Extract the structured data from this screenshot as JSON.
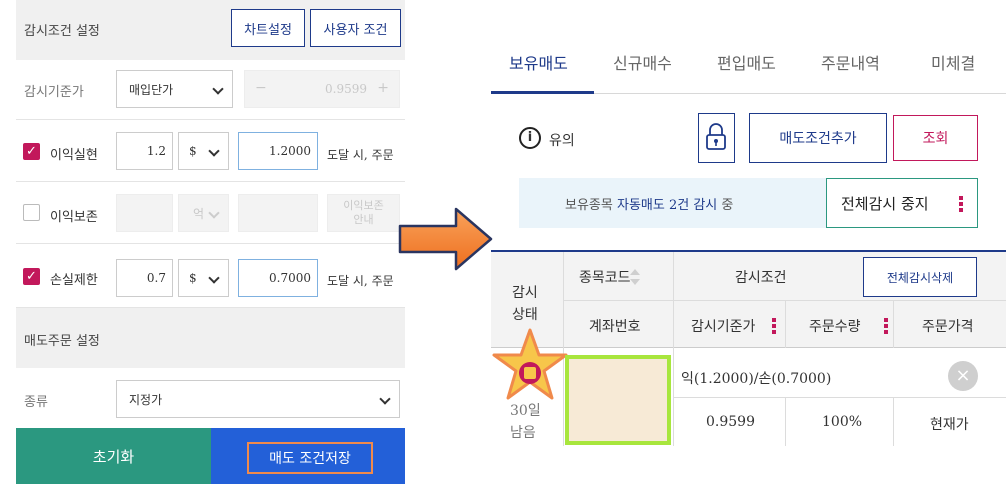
{
  "left": {
    "header_title": "감시조건 설정",
    "chart_settings": "차트설정",
    "user_condition": "사용자 조건",
    "base_price": {
      "label": "감시기준가",
      "select": "매입단가",
      "minus": "−",
      "value": "0.9599",
      "plus": "+"
    },
    "profit_realize": {
      "label": "이익실현",
      "checked": true,
      "amount": "1.2",
      "unit": "$",
      "price": "1.2000",
      "after": "도달 시, 주문"
    },
    "profit_preserve": {
      "label": "이익보존",
      "checked": false,
      "unit": "억",
      "button": [
        "이익보존",
        "안내"
      ]
    },
    "loss_limit": {
      "label": "손실제한",
      "checked": true,
      "amount": "0.7",
      "unit": "$",
      "price": "0.7000",
      "after": "도달 시, 주문"
    },
    "sell_order_title": "매도주문 설정",
    "type": {
      "label": "종류",
      "select": "지정가"
    },
    "reset": "초기화",
    "save": "매도 조건저장"
  },
  "right": {
    "tabs": [
      "보유매도",
      "신규매수",
      "편입매도",
      "주문내역",
      "미체결"
    ],
    "info_icon": "i",
    "info_label": "유의",
    "add_sell_condition": "매도조건추가",
    "query": "조회",
    "notice": {
      "prefix": "보유종목 ",
      "highlight": "자동매도 2건 감시",
      "suffix": " 중"
    },
    "stop_all": "전체감시 중지",
    "table": {
      "status_header": [
        "감시",
        "상태"
      ],
      "code_header": "종목코드",
      "account_header": "계좌번호",
      "condition_header": "감시조건",
      "delete_all": "전체감시삭제",
      "base_header": "감시기준가",
      "qty_header": "주문수량",
      "price_header": "주문가격",
      "row": {
        "condition": "익(1.2000)/손(0.7000)",
        "remaining": [
          "30일",
          "남음"
        ],
        "base": "0.9599",
        "qty": "100%",
        "price": "현재가"
      }
    }
  },
  "colors": {
    "navy": "#1e3a8a",
    "pink": "#c2185b",
    "teal": "#2b9880",
    "blue": "#2360d8",
    "orange": "#f08a4b"
  }
}
